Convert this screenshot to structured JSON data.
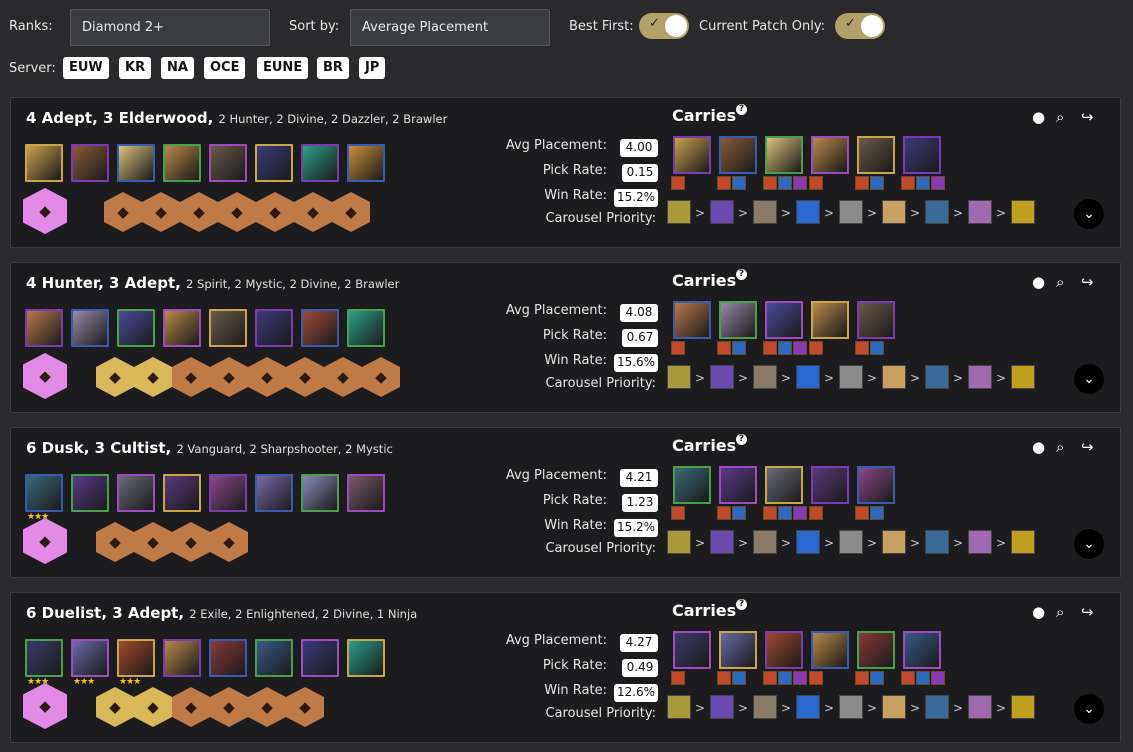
{
  "filters": {
    "ranks_label": "Ranks:",
    "ranks_value": "Diamond 2+",
    "sort_label": "Sort by:",
    "sort_value": "Average Placement",
    "best_first_label": "Best First:",
    "current_patch_label": "Current Patch Only:",
    "best_first_on": true,
    "current_patch_on": true,
    "server_label": "Server:",
    "servers": [
      "EUW",
      "KR",
      "NA",
      "OCE",
      "EUNE",
      "BR",
      "JP"
    ]
  },
  "labels": {
    "avg": "Avg Placement:",
    "pick": "Pick Rate:",
    "win": "Win Rate:",
    "carousel": "Carousel Priority:",
    "carries": "Carries"
  },
  "comps": [
    {
      "title": "4 Adept, 3 Elderwood,",
      "subtitle": "2 Hunter, 2 Divine, 2 Dazzler, 2 Brawler",
      "avg": "4.00",
      "pick": "0.15",
      "win": "15.2%"
    },
    {
      "title": "4 Hunter, 3 Adept,",
      "subtitle": "2 Spirit, 2 Mystic, 2 Divine, 2 Brawler",
      "avg": "4.08",
      "pick": "0.67",
      "win": "15.6%"
    },
    {
      "title": "6 Dusk, 3 Cultist,",
      "subtitle": "2 Vanguard, 2 Sharpshooter, 2 Mystic",
      "avg": "4.21",
      "pick": "1.23",
      "win": "15.2%"
    },
    {
      "title": "6 Duelist, 3 Adept,",
      "subtitle": "2 Exile, 2 Enlightened, 2 Divine, 1 Ninja",
      "avg": "4.27",
      "pick": "0.49",
      "win": "12.6%"
    }
  ],
  "colors": {
    "accent_gold": "#b3a16a",
    "bronze": "#c07a45",
    "gold_hex": "#d9b85a",
    "chromatic": "#e38ae6"
  }
}
